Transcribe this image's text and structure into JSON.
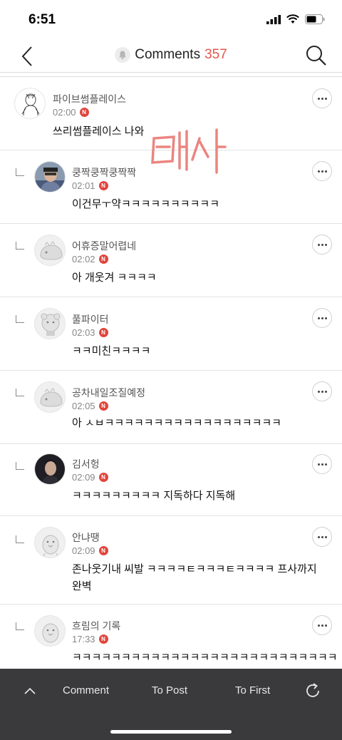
{
  "status": {
    "time": "6:51"
  },
  "header": {
    "title": "Comments",
    "count": "357"
  },
  "comments": [
    {
      "nick": "파이브썸플레이스",
      "time": "02:00",
      "badge": "N",
      "text": "쓰리썸플레이스 나와",
      "reply": false
    },
    {
      "nick": "쿵짝쿵짝쿵짝짝",
      "time": "02:01",
      "badge": "N",
      "text": "이건무ㅜ약ㅋㅋㅋㅋㅋㅋㅋㅋㅋㅋ",
      "reply": true
    },
    {
      "nick": "어휴증말어렵네",
      "time": "02:02",
      "badge": "N",
      "text": "아 개웃겨 ㅋㅋㅋㅋ",
      "reply": true
    },
    {
      "nick": "풀파이터",
      "time": "02:03",
      "badge": "N",
      "text": "ㅋㅋ미친ㅋㅋㅋㅋ",
      "reply": true
    },
    {
      "nick": "공차내일조질예정",
      "time": "02:05",
      "badge": "N",
      "text": "아 ㅅㅂㅋㅋㅋㅋㅋㅋㅋㅋㅋㅋㅋㅋㅋㅋㅋㅋㅋㅋ",
      "reply": true
    },
    {
      "nick": "김서헝",
      "time": "02:09",
      "badge": "N",
      "text": "ㅋㅋㅋㅋㅋㅋㅋㅋㅋ 지독하다 지독해",
      "reply": true
    },
    {
      "nick": "안냐땡",
      "time": "02:09",
      "badge": "N",
      "text_line1": "존나웃기내 씨발 ㅋㅋㅋㅋㅌㅋㅋㅋㅌㅋㅋㅋㅋ 프사까지",
      "text_line2": "완벽",
      "reply": true
    },
    {
      "nick": "흐림의 기록",
      "time": "17:33",
      "badge": "N",
      "text": "ㅋㅋㅋㅋㅋㅋㅋㅋㅋㅋㅋㅋㅋㅋㅋㅋㅋㅋㅋㅋㅋㅋㅋㅋㅋㅋㅋ",
      "reply": true
    }
  ],
  "bottom_bar": {
    "comment": "Comment",
    "to_post": "To Post",
    "to_first": "To First"
  },
  "colors": {
    "accent": "#e0564c",
    "badge": "#e0453c",
    "bottom_bar": "#3a3a3c"
  }
}
